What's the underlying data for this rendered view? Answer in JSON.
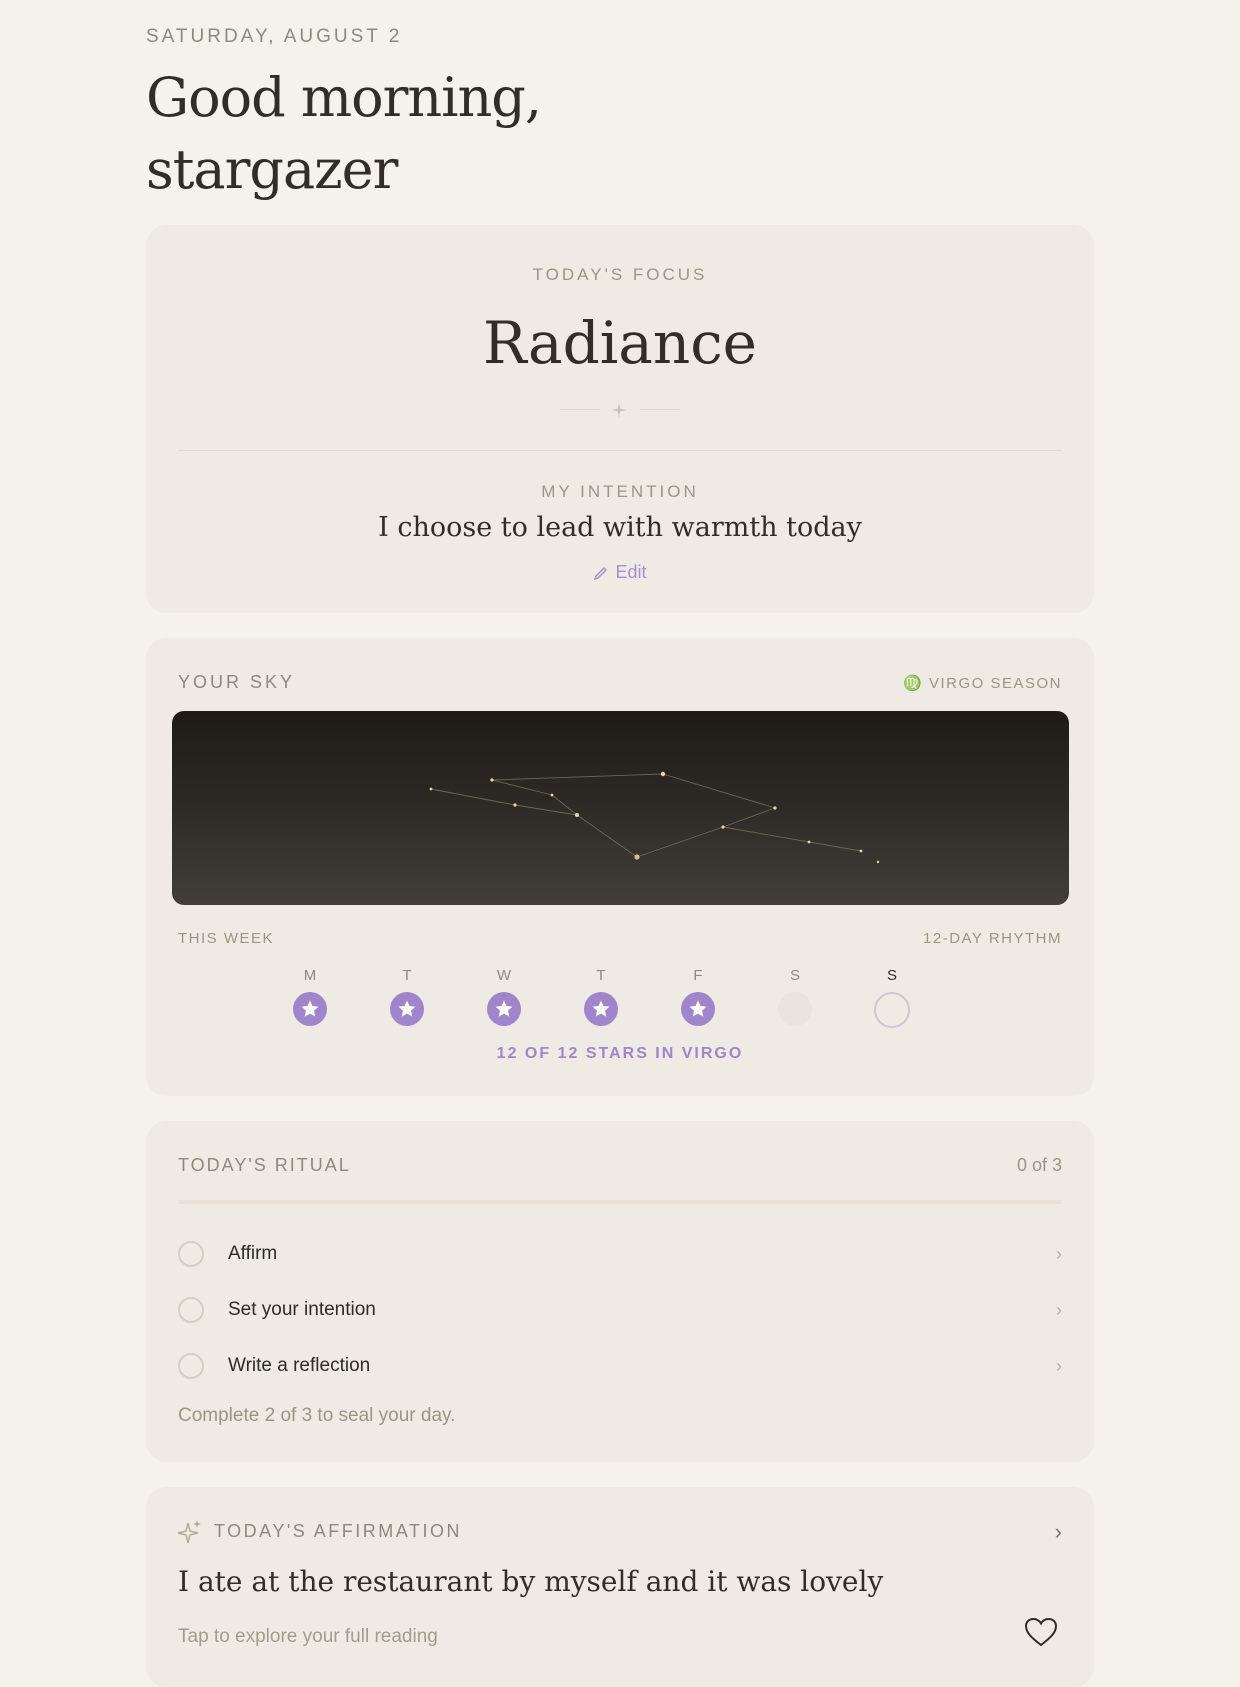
{
  "header": {
    "date": "SATURDAY, AUGUST 2",
    "greeting_line1": "Good morning,",
    "greeting_line2": "stargazer"
  },
  "focus": {
    "eyebrow": "TODAY'S FOCUS",
    "word": "Radiance",
    "intention_eyebrow": "MY INTENTION",
    "intention": "I choose to lead with warmth today",
    "edit_label": "Edit"
  },
  "sky": {
    "title": "YOUR SKY",
    "season": "♍ VIRGO SEASON",
    "week_label": "THIS WEEK",
    "rhythm_label": "12-DAY RHYTHM",
    "days": [
      {
        "label": "M",
        "state": "done"
      },
      {
        "label": "T",
        "state": "done"
      },
      {
        "label": "W",
        "state": "done"
      },
      {
        "label": "T",
        "state": "done"
      },
      {
        "label": "F",
        "state": "done"
      },
      {
        "label": "S",
        "state": "empty"
      },
      {
        "label": "S",
        "state": "today"
      }
    ],
    "progress_text": "12 OF 12 STARS IN VIRGO"
  },
  "ritual": {
    "title": "TODAY'S RITUAL",
    "count": "0 of 3",
    "items": [
      {
        "label": "Affirm"
      },
      {
        "label": "Set your intention"
      },
      {
        "label": "Write a reflection"
      }
    ],
    "footer": "Complete 2 of 3 to seal your day."
  },
  "affirmation": {
    "title": "TODAY'S AFFIRMATION",
    "text": "I ate at the restaurant by myself and it was lovely",
    "hint": "Tap to explore your full reading"
  },
  "colors": {
    "background": "#f5f2ec",
    "card": "#efebe4",
    "accent": "#9f85cc",
    "muted": "#9c9487"
  }
}
